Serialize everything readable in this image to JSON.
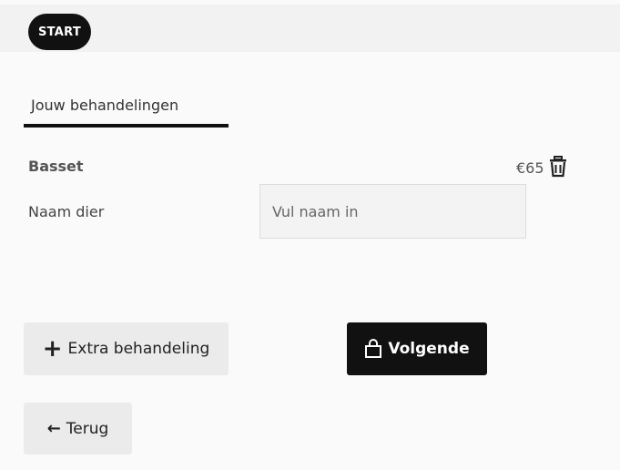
{
  "header": {
    "start_label": "START"
  },
  "tabs": [
    {
      "label": "Jouw behandelingen"
    }
  ],
  "treatment": {
    "name": "Basset",
    "price": "€65",
    "pet_name_label": "Naam dier",
    "pet_name_placeholder": "Vul naam in",
    "pet_name_value": ""
  },
  "actions": {
    "extra_label": "Extra behandeling",
    "next_label": "Volgende",
    "back_label": "Terug"
  },
  "icons": {
    "delete": "trash-icon",
    "add": "plus-icon",
    "next": "shopping-bag-icon",
    "back": "arrow-left-icon"
  },
  "colors": {
    "primary": "#111111",
    "secondary_button": "#ebebeb",
    "background": "#fafafa"
  }
}
